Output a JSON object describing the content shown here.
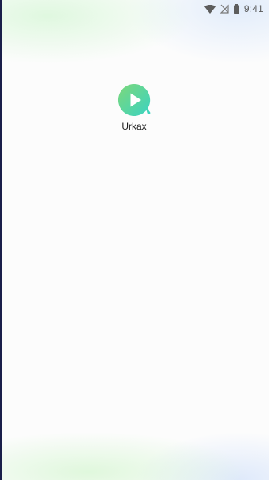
{
  "status_bar": {
    "time": "9:41",
    "icons": [
      "wifi-icon",
      "no-signal-icon",
      "battery-icon"
    ]
  },
  "home_screen": {
    "apps": [
      {
        "label": "Urkax",
        "icon": "play-icon"
      }
    ]
  },
  "colors": {
    "icon_gradient_start": "#7dd87a",
    "icon_gradient_end": "#3ad3c2",
    "status_icon": "#5d5d5d"
  }
}
